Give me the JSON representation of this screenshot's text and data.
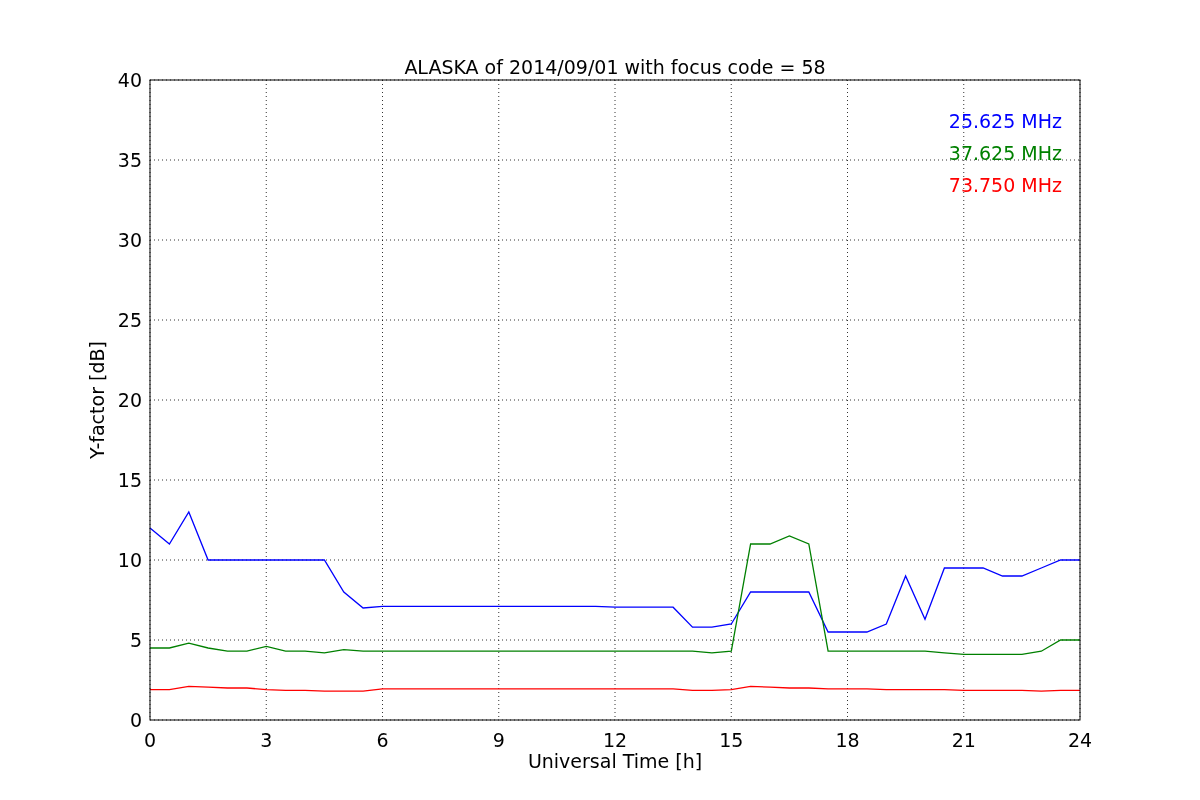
{
  "chart_data": {
    "type": "line",
    "title": "ALASKA of 2014/09/01 with focus code = 58",
    "xlabel": "Universal Time [h]",
    "ylabel": "Y-factor [dB]",
    "x": [
      0,
      0.5,
      1,
      1.5,
      2,
      2.5,
      3,
      3.5,
      4,
      4.5,
      5,
      5.5,
      6,
      6.5,
      7,
      7.5,
      8,
      8.5,
      9,
      9.5,
      10,
      10.5,
      11,
      11.5,
      12,
      12.5,
      13,
      13.5,
      14,
      14.5,
      15,
      15.5,
      16,
      16.5,
      17,
      17.5,
      18,
      18.5,
      19,
      19.5,
      20,
      20.5,
      21,
      21.5,
      22,
      22.5,
      23,
      23.5,
      24
    ],
    "series": [
      {
        "name": "25.625 MHz",
        "color": "#0000ff",
        "values": [
          12,
          11,
          13,
          10,
          10,
          10,
          10,
          10,
          10,
          10,
          8,
          7,
          7.1,
          7.1,
          7.1,
          7.1,
          7.1,
          7.1,
          7.1,
          7.1,
          7.1,
          7.1,
          7.1,
          7.1,
          7.05,
          7.05,
          7.05,
          7.05,
          5.8,
          5.8,
          6,
          8,
          8,
          8,
          8,
          5.5,
          5.5,
          5.5,
          6,
          9,
          6.3,
          9.5,
          9.5,
          9.5,
          9,
          9,
          9.5,
          10,
          10
        ]
      },
      {
        "name": "37.625 MHz",
        "color": "#008000",
        "values": [
          4.5,
          4.5,
          4.8,
          4.5,
          4.3,
          4.3,
          4.6,
          4.3,
          4.3,
          4.2,
          4.4,
          4.3,
          4.3,
          4.3,
          4.3,
          4.3,
          4.3,
          4.3,
          4.3,
          4.3,
          4.3,
          4.3,
          4.3,
          4.3,
          4.3,
          4.3,
          4.3,
          4.3,
          4.3,
          4.2,
          4.3,
          11,
          11,
          11.5,
          11,
          4.3,
          4.3,
          4.3,
          4.3,
          4.3,
          4.3,
          4.2,
          4.1,
          4.1,
          4.1,
          4.1,
          4.3,
          5,
          5
        ]
      },
      {
        "name": "73.750 MHz",
        "color": "#ff0000",
        "values": [
          1.9,
          1.9,
          2.1,
          2.05,
          2,
          2,
          1.9,
          1.85,
          1.85,
          1.8,
          1.8,
          1.8,
          1.95,
          1.95,
          1.95,
          1.95,
          1.95,
          1.95,
          1.95,
          1.95,
          1.95,
          1.95,
          1.95,
          1.95,
          1.95,
          1.95,
          1.95,
          1.95,
          1.85,
          1.85,
          1.9,
          2.1,
          2.05,
          2,
          2,
          1.95,
          1.95,
          1.95,
          1.9,
          1.9,
          1.9,
          1.9,
          1.85,
          1.85,
          1.85,
          1.85,
          1.8,
          1.85,
          1.85
        ]
      }
    ],
    "grid": true,
    "xlim": [
      0,
      24
    ],
    "ylim": [
      0,
      40
    ],
    "xticks": [
      0,
      3,
      6,
      9,
      12,
      15,
      18,
      21,
      24
    ],
    "yticks": [
      0,
      5,
      10,
      15,
      20,
      25,
      30,
      35,
      40
    ]
  }
}
